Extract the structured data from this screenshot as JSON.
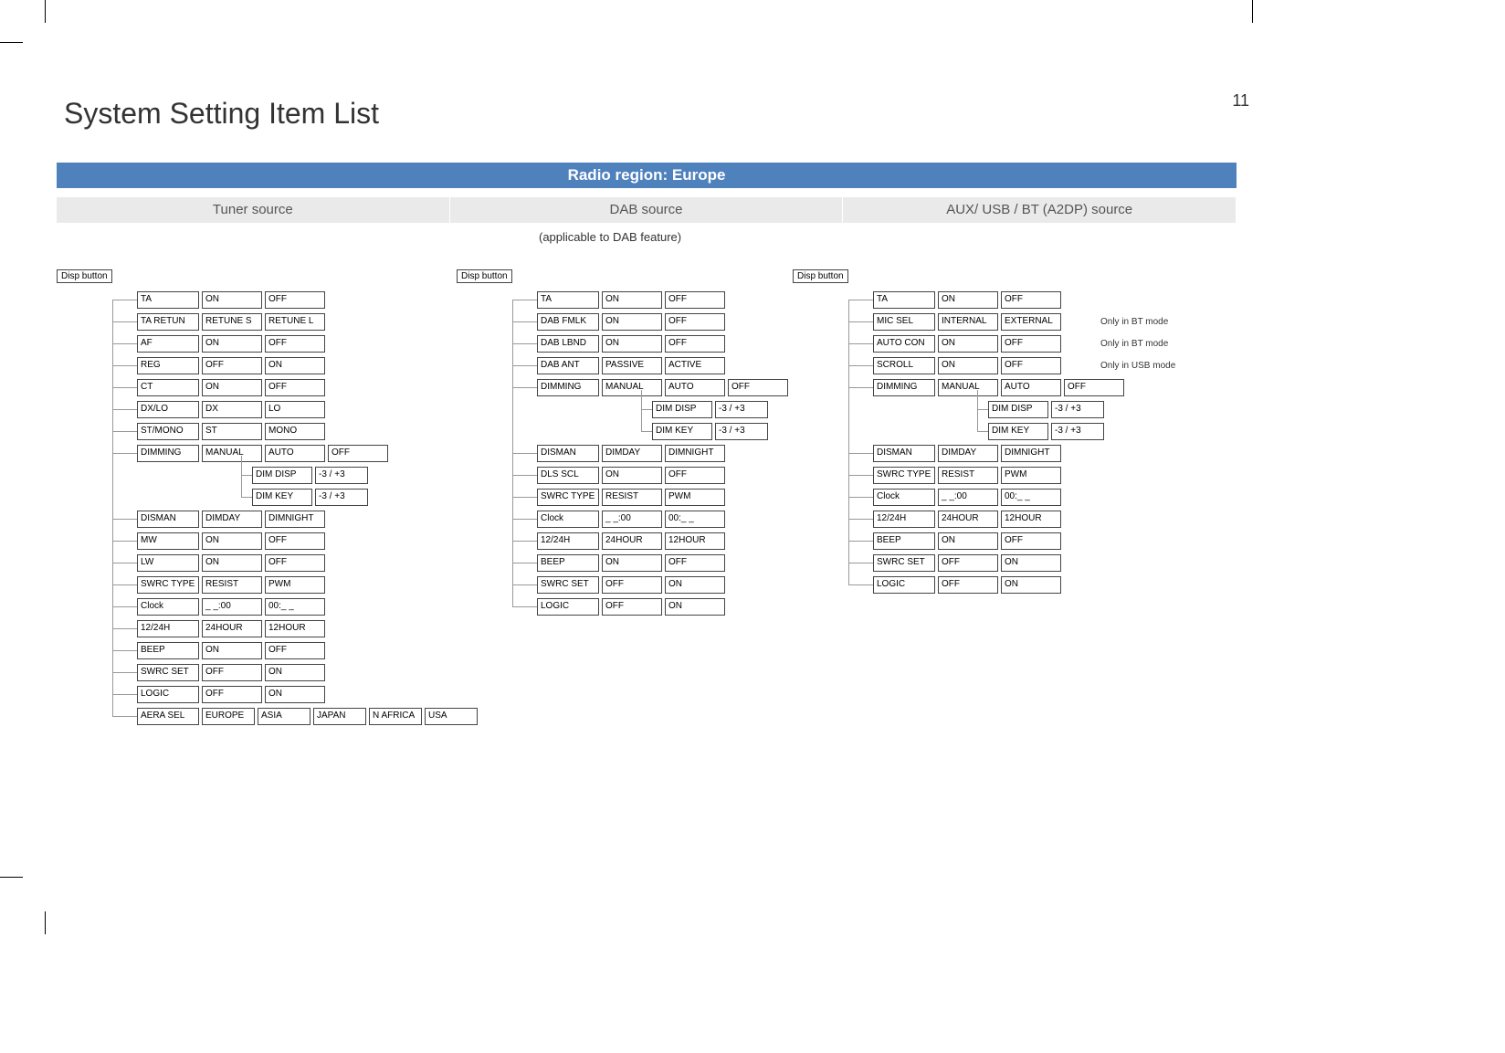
{
  "page_number": "11",
  "page_title": "System Setting Item List",
  "region_band": "Radio region: Europe",
  "subheads": [
    "Tuner source",
    "DAB source",
    "AUX/ USB / BT (A2DP) source"
  ],
  "dab_note": "(applicable to DAB feature)",
  "disp_button": "Disp button",
  "columns": [
    {
      "items": [
        {
          "label": "TA",
          "opts": [
            "ON",
            "OFF"
          ]
        },
        {
          "label": "TA RETUN",
          "opts": [
            "RETUNE S",
            "RETUNE L"
          ]
        },
        {
          "label": "AF",
          "opts": [
            "ON",
            "OFF"
          ]
        },
        {
          "label": "REG",
          "opts": [
            "OFF",
            "ON"
          ]
        },
        {
          "label": "CT",
          "opts": [
            "ON",
            "OFF"
          ]
        },
        {
          "label": "DX/LO",
          "opts": [
            "DX",
            "LO"
          ]
        },
        {
          "label": "ST/MONO",
          "opts": [
            "ST",
            "MONO"
          ]
        },
        {
          "label": "DIMMING",
          "opts": [
            "MANUAL",
            "AUTO",
            "OFF"
          ],
          "sub": [
            {
              "label": "DIM DISP",
              "opts": [
                "-3 / +3"
              ]
            },
            {
              "label": "DIM KEY",
              "opts": [
                "-3 / +3"
              ]
            }
          ]
        },
        {
          "label": "DISMAN",
          "opts": [
            "DIMDAY",
            "DIMNIGHT"
          ]
        },
        {
          "label": "MW",
          "opts": [
            "ON",
            "OFF"
          ]
        },
        {
          "label": "LW",
          "opts": [
            "ON",
            "OFF"
          ]
        },
        {
          "label": "SWRC TYPE",
          "opts": [
            "RESIST",
            "PWM"
          ]
        },
        {
          "label": "Clock",
          "opts": [
            "_ _:00",
            "00:_ _"
          ]
        },
        {
          "label": "12/24H",
          "opts": [
            "24HOUR",
            "12HOUR"
          ]
        },
        {
          "label": "BEEP",
          "opts": [
            "ON",
            "OFF"
          ]
        },
        {
          "label": "SWRC SET",
          "opts": [
            "OFF",
            "ON"
          ]
        },
        {
          "label": "LOGIC",
          "opts": [
            "OFF",
            "ON"
          ]
        },
        {
          "label": "AERA SEL",
          "opts": [
            "EUROPE",
            "ASIA",
            "JAPAN",
            "N AFRICA",
            "USA"
          ]
        }
      ]
    },
    {
      "items": [
        {
          "label": "TA",
          "opts": [
            "ON",
            "OFF"
          ]
        },
        {
          "label": "DAB FMLK",
          "opts": [
            "ON",
            "OFF"
          ]
        },
        {
          "label": "DAB  LBND",
          "opts": [
            "ON",
            "OFF"
          ]
        },
        {
          "label": "DAB ANT",
          "opts": [
            "PASSIVE",
            "ACTIVE"
          ]
        },
        {
          "label": "DIMMING",
          "opts": [
            "MANUAL",
            "AUTO",
            "OFF"
          ],
          "sub": [
            {
              "label": "DIM DISP",
              "opts": [
                "-3 / +3"
              ]
            },
            {
              "label": "DIM KEY",
              "opts": [
                "-3 / +3"
              ]
            }
          ]
        },
        {
          "label": "DISMAN",
          "opts": [
            "DIMDAY",
            "DIMNIGHT"
          ]
        },
        {
          "label": "DLS SCL",
          "opts": [
            "ON",
            "OFF"
          ]
        },
        {
          "label": "SWRC TYPE",
          "opts": [
            "RESIST",
            "PWM"
          ]
        },
        {
          "label": "Clock",
          "opts": [
            "_ _:00",
            "00:_ _"
          ]
        },
        {
          "label": "12/24H",
          "opts": [
            "24HOUR",
            "12HOUR"
          ]
        },
        {
          "label": "BEEP",
          "opts": [
            "ON",
            "OFF"
          ]
        },
        {
          "label": "SWRC SET",
          "opts": [
            "OFF",
            "ON"
          ]
        },
        {
          "label": "LOGIC",
          "opts": [
            "OFF",
            "ON"
          ]
        }
      ]
    },
    {
      "items": [
        {
          "label": "TA",
          "opts": [
            "ON",
            "OFF"
          ]
        },
        {
          "label": "MIC SEL",
          "opts": [
            "INTERNAL",
            "EXTERNAL"
          ],
          "aside": "Only in BT mode"
        },
        {
          "label": "AUTO CON",
          "opts": [
            "ON",
            "OFF"
          ],
          "aside": "Only in BT mode"
        },
        {
          "label": "SCROLL",
          "opts": [
            "ON",
            "OFF"
          ],
          "aside": "Only in USB mode"
        },
        {
          "label": "DIMMING",
          "opts": [
            "MANUAL",
            "AUTO",
            "OFF"
          ],
          "sub": [
            {
              "label": "DIM DISP",
              "opts": [
                "-3 / +3"
              ]
            },
            {
              "label": "DIM KEY",
              "opts": [
                "-3 / +3"
              ]
            }
          ]
        },
        {
          "label": "DISMAN",
          "opts": [
            "DIMDAY",
            "DIMNIGHT"
          ]
        },
        {
          "label": "SWRC TYPE",
          "opts": [
            "RESIST",
            "PWM"
          ]
        },
        {
          "label": "Clock",
          "opts": [
            "_ _:00",
            "00:_ _"
          ]
        },
        {
          "label": "12/24H",
          "opts": [
            "24HOUR",
            "12HOUR"
          ]
        },
        {
          "label": "BEEP",
          "opts": [
            "ON",
            "OFF"
          ]
        },
        {
          "label": "SWRC SET",
          "opts": [
            "OFF",
            "ON"
          ]
        },
        {
          "label": "LOGIC",
          "opts": [
            "OFF",
            "ON"
          ]
        }
      ]
    }
  ]
}
